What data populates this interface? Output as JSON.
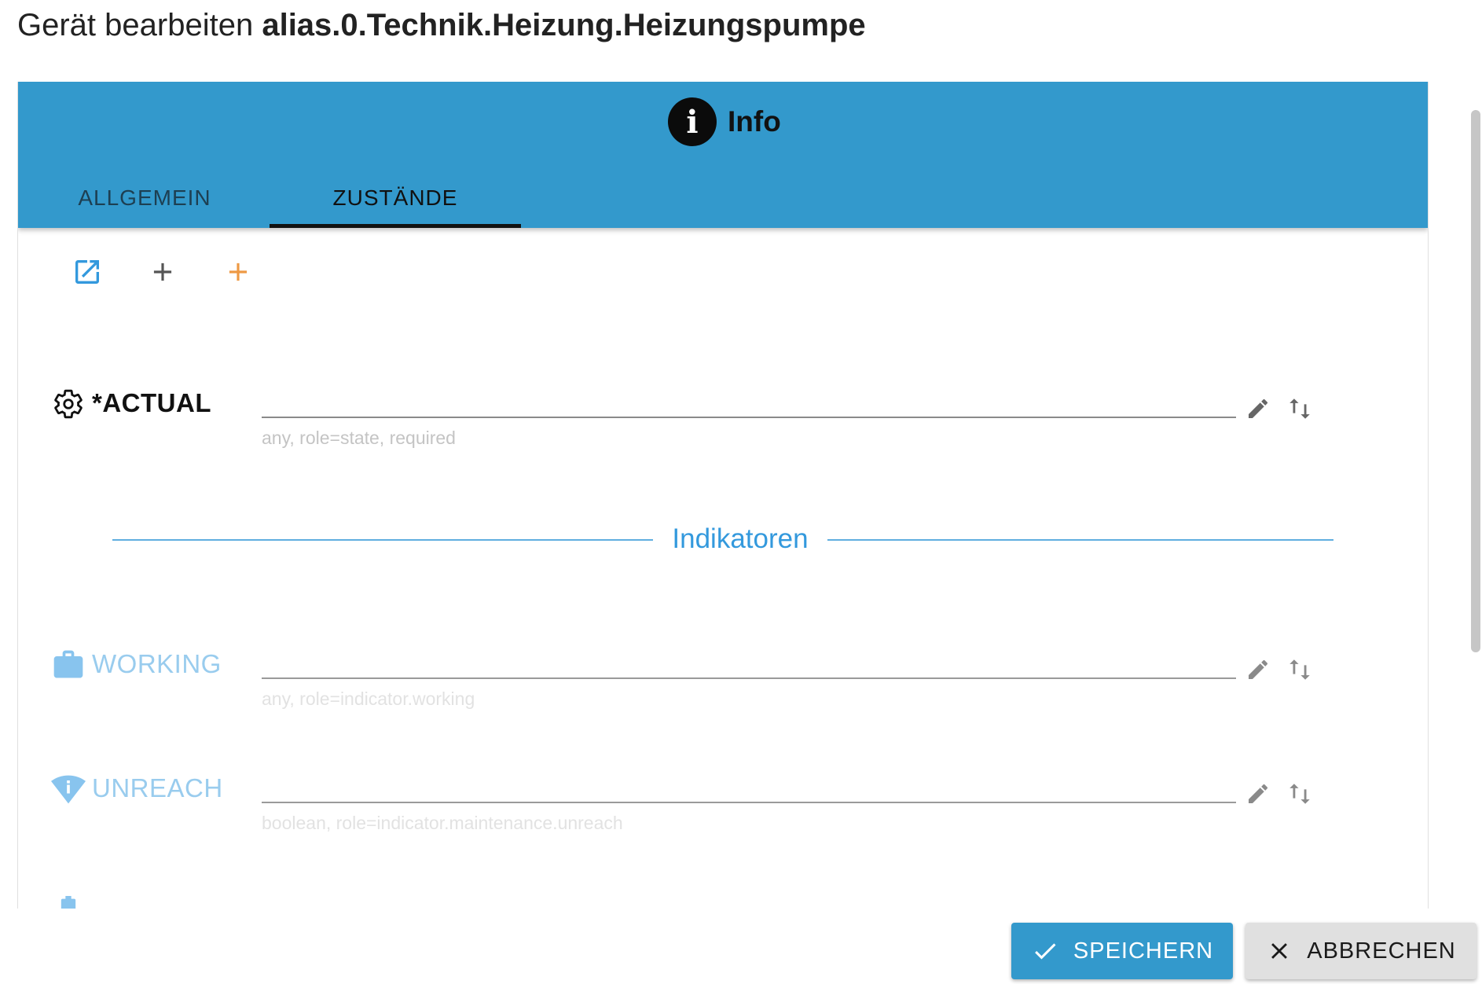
{
  "dialog": {
    "title_prefix": "Gerät bearbeiten",
    "device_id": "alias.0.Technik.Heizung.Heizungspumpe"
  },
  "header": {
    "section_icon": "info-icon",
    "section_title": "Info",
    "info_glyph": "i",
    "tabs": [
      {
        "label": "ALLGEMEIN",
        "active": false
      },
      {
        "label": "ZUSTÄNDE",
        "active": true
      }
    ]
  },
  "toolbar": {
    "items": [
      {
        "icon": "open-in-new-icon",
        "color": "#3399dd"
      },
      {
        "icon": "add-icon",
        "color": "#555555"
      },
      {
        "icon": "add-icon",
        "color": "#ee9944"
      }
    ]
  },
  "states": {
    "actual": {
      "icon": "gear-icon",
      "label": "*ACTUAL",
      "hint": "any, role=state, required"
    },
    "divider_label": "Indikatoren",
    "working": {
      "icon": "briefcase-icon",
      "label": "WORKING",
      "hint": "any, role=indicator.working"
    },
    "unreach": {
      "icon": "wifi-info-icon",
      "label": "UNREACH",
      "hint": "boolean, role=indicator.maintenance.unreach"
    },
    "lowbat": {
      "icon": "battery-icon"
    }
  },
  "actions": {
    "save_label": "SPEICHERN",
    "cancel_label": "ABBRECHEN"
  },
  "colors": {
    "header_bg": "#3399cc",
    "accent": "#3399dd",
    "optional_label": "#99ccee"
  }
}
